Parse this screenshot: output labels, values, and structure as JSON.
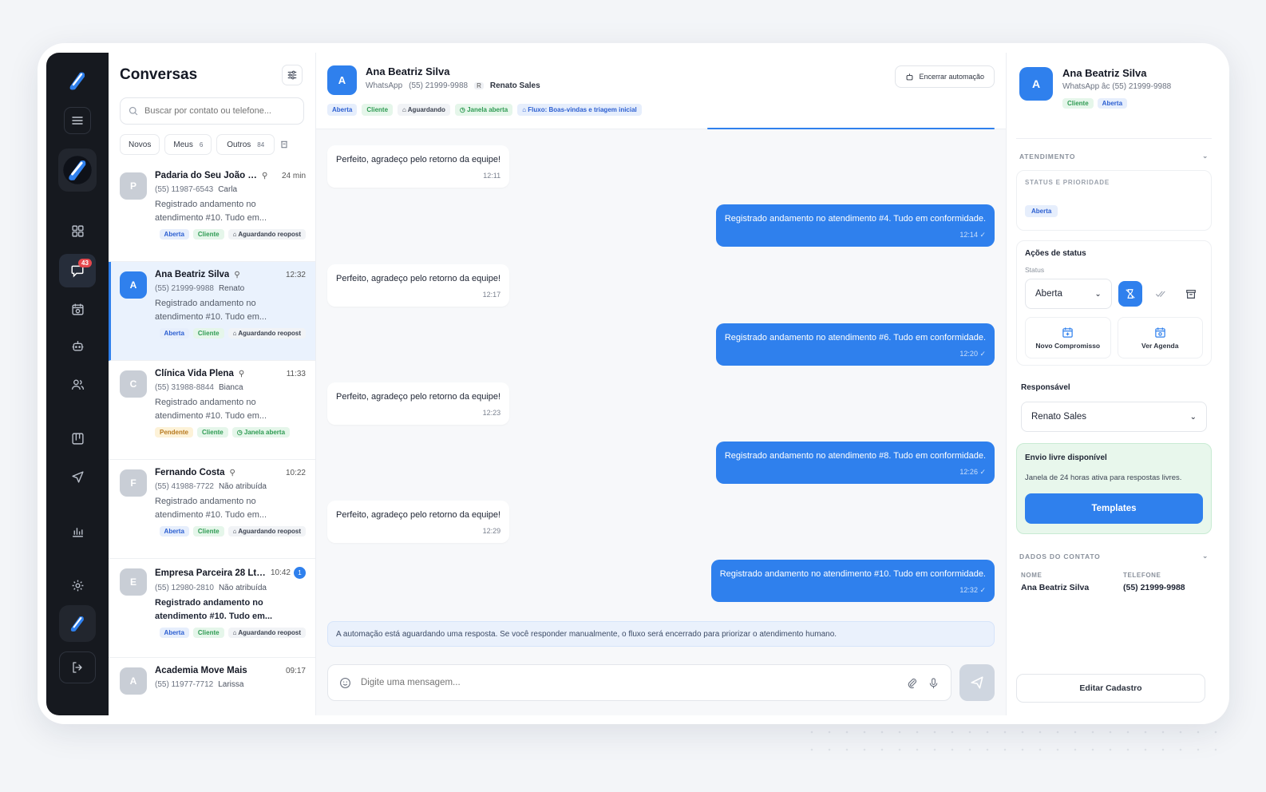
{
  "sidebar": {
    "chat_badge": "43"
  },
  "list": {
    "title": "Conversas",
    "search_placeholder": "Buscar por contato ou telefone...",
    "filters": [
      {
        "label": "Novos",
        "count": ""
      },
      {
        "label": "Meus",
        "count": "6"
      },
      {
        "label": "Outros",
        "count": "84"
      }
    ],
    "conversations": [
      {
        "initial": "P",
        "name": "Padaria do Seu João L...",
        "time": "24 min",
        "phone": "(55) 11987-6543",
        "agent": "Carla",
        "preview": "Registrado andamento no atendimento #10. Tudo em...",
        "tags": [
          "Aberta",
          "Cliente",
          "Aguardando reopost"
        ]
      },
      {
        "initial": "A",
        "name": "Ana Beatriz Silva",
        "time": "12:32",
        "phone": "(55) 21999-9988",
        "agent": "Renato",
        "preview": "Registrado andamento no atendimento #10. Tudo em...",
        "tags": [
          "Aberta",
          "Cliente",
          "Aguardando reopost"
        ]
      },
      {
        "initial": "C",
        "name": "Clínica Vida Plena",
        "time": "11:33",
        "phone": "(55) 31988-8844",
        "agent": "Bianca",
        "preview": "Registrado andamento no atendimento #10. Tudo em...",
        "tags": [
          "Pendente",
          "Cliente",
          "Janela aberta"
        ]
      },
      {
        "initial": "F",
        "name": "Fernando Costa",
        "time": "10:22",
        "phone": "(55) 41988-7722",
        "agent": "Não atribuída",
        "preview": "Registrado andamento no atendimento #10. Tudo em...",
        "tags": [
          "Aberta",
          "Cliente",
          "Aguardando reopost"
        ]
      },
      {
        "initial": "E",
        "name": "Empresa Parceira 28 Ltda",
        "time": "10:42",
        "unread": "1",
        "phone": "(55) 12980-2810",
        "agent": "Não atribuída",
        "preview": "Registrado andamento no atendimento #10. Tudo em...",
        "tags": [
          "Aberta",
          "Cliente",
          "Aguardando reopost"
        ]
      },
      {
        "initial": "A",
        "name": "Academia Move Mais",
        "time": "09:17",
        "phone": "(55) 11977-7712",
        "agent": "Larissa",
        "preview": "",
        "tags": []
      }
    ]
  },
  "chat": {
    "initial": "A",
    "name": "Ana Beatriz Silva",
    "channel": "WhatsApp",
    "phone": "(55) 21999-9988",
    "agent_initial": "R",
    "agent": "Renato Sales",
    "end_automation": "Encerrar automação",
    "tags": [
      "Aberta",
      "Cliente",
      "Aguardando",
      "Janela aberta",
      "Fluxo: Boas-vindas e triagem inicial"
    ],
    "messages": [
      {
        "dir": "in",
        "text": "Perfeito, agradeço pelo retorno da equipe!",
        "time": "12:11"
      },
      {
        "dir": "out",
        "text": "Registrado andamento no atendimento #4. Tudo em conformidade.",
        "time": "12:14 ✓"
      },
      {
        "dir": "in",
        "text": "Perfeito, agradeço pelo retorno da equipe!",
        "time": "12:17"
      },
      {
        "dir": "out",
        "text": "Registrado andamento no atendimento #6. Tudo em conformidade.",
        "time": "12:20 ✓"
      },
      {
        "dir": "in",
        "text": "Perfeito, agradeço pelo retorno da equipe!",
        "time": "12:23"
      },
      {
        "dir": "out",
        "text": "Registrado andamento no atendimento #8. Tudo em conformidade.",
        "time": "12:26 ✓"
      },
      {
        "dir": "in",
        "text": "Perfeito, agradeço pelo retorno da equipe!",
        "time": "12:29"
      },
      {
        "dir": "out",
        "text": "Registrado andamento no atendimento #10. Tudo em conformidade.",
        "time": "12:32 ✓"
      }
    ],
    "automation_note": "A automação está aguardando uma resposta. Se você responder manualmente, o fluxo será encerrado para priorizar o atendimento humano.",
    "composer_placeholder": "Digite uma mensagem..."
  },
  "panel": {
    "initial": "A",
    "name": "Ana Beatriz Silva",
    "sub": "WhatsApp âc (55) 21999-9988",
    "tags": [
      "Cliente",
      "Aberta"
    ],
    "section_atendimento": "ATENDIMENTO",
    "status_priority_title": "STATUS E PRIORIDADE",
    "status_badge": "Aberta",
    "status_actions_title": "Ações de status",
    "status_label": "Status",
    "status_value": "Aberta",
    "new_appointment": "Novo Compromisso",
    "view_agenda": "Ver Agenda",
    "responsible_title": "Responsável",
    "responsible_value": "Renato Sales",
    "free_title": "Envio livre disponível",
    "free_desc": "Janela de 24 horas ativa para respostas livres.",
    "templates": "Templates",
    "section_contact": "DADOS DO CONTATO",
    "name_label": "NOME",
    "name_value": "Ana Beatriz Silva",
    "phone_label": "TELEFONE",
    "phone_value": "(55) 21999-9988",
    "edit": "Editar Cadastro"
  },
  "colors": {
    "accent": "#2f80ed",
    "rail": "#16191f",
    "badge": "#e5484d",
    "free_bg": "#e8f7ec"
  }
}
